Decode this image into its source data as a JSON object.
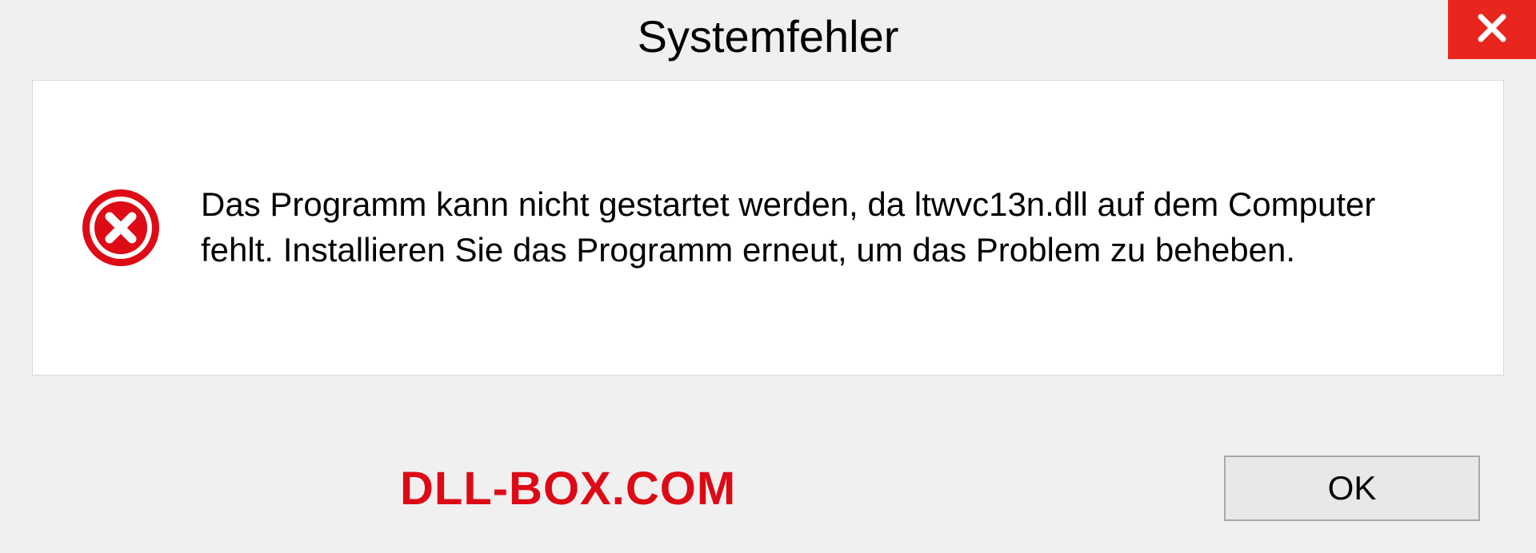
{
  "dialog": {
    "title": "Systemfehler",
    "message": "Das Programm kann nicht gestartet werden, da ltwvc13n.dll auf dem Computer fehlt. Installieren Sie das Programm erneut, um das Problem zu beheben.",
    "ok_label": "OK"
  },
  "watermark": {
    "text": "DLL-BOX.COM"
  },
  "colors": {
    "close_button": "#e9261d",
    "error_icon": "#de0a15",
    "watermark": "#dd0a16"
  }
}
